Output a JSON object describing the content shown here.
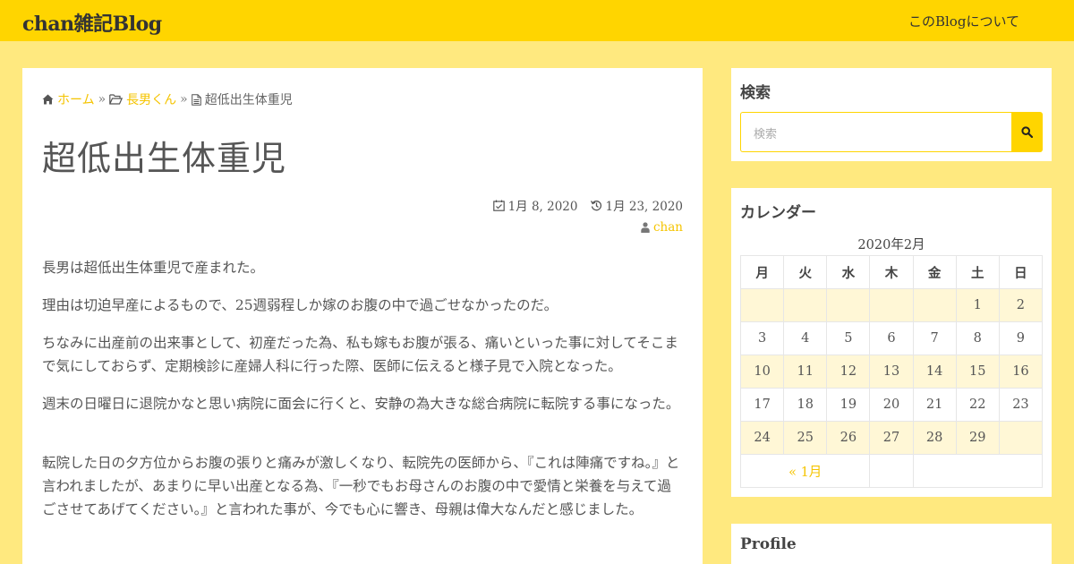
{
  "header": {
    "site_title": "chan雑記Blog",
    "nav_about": "このBlogについて"
  },
  "breadcrumb": {
    "home": "ホーム",
    "separator": "»",
    "category": "長男くん",
    "current": "超低出生体重児"
  },
  "post": {
    "title": "超低出生体重児",
    "published": "1月 8, 2020",
    "updated": "1月 23, 2020",
    "author": "chan",
    "paragraphs": [
      "長男は超低出生体重児で産まれた。",
      "理由は切迫早産によるもので、25週弱程しか嫁のお腹の中で過ごせなかったのだ。",
      "ちなみに出産前の出来事として、初産だった為、私も嫁もお腹が張る、痛いといった事に対してそこまで気にしておらず、定期検診に産婦人科に行った際、医師に伝えると様子見で入院となった。",
      "週末の日曜日に退院かなと思い病院に面会に行くと、安静の為大きな総合病院に転院する事になった。",
      "転院した日の夕方位からお腹の張りと痛みが激しくなり、転院先の医師から、『これは陣痛ですね。』と言われましたが、あまりに早い出産となる為、『一秒でもお母さんのお腹の中で愛情と栄養を与えて過ごさせてあげてください。』と言われた事が、今でも心に響き、母親は偉大なんだと感じました。"
    ]
  },
  "sidebar": {
    "search": {
      "title": "検索",
      "placeholder": "検索"
    },
    "calendar": {
      "title": "カレンダー",
      "caption": "2020年2月",
      "weekdays": [
        "月",
        "火",
        "水",
        "木",
        "金",
        "土",
        "日"
      ],
      "rows": [
        [
          "",
          "",
          "",
          "",
          "",
          "1",
          "2"
        ],
        [
          "3",
          "4",
          "5",
          "6",
          "7",
          "8",
          "9"
        ],
        [
          "10",
          "11",
          "12",
          "13",
          "14",
          "15",
          "16"
        ],
        [
          "17",
          "18",
          "19",
          "20",
          "21",
          "22",
          "23"
        ],
        [
          "24",
          "25",
          "26",
          "27",
          "28",
          "29",
          ""
        ]
      ],
      "prev_link": "« 1月"
    },
    "profile": {
      "title": "Profile"
    }
  },
  "colors": {
    "header_bg": "#ffd500",
    "page_bg": "#ffe97f",
    "accent": "#f5c400",
    "cal_highlight": "#fff7d6"
  }
}
